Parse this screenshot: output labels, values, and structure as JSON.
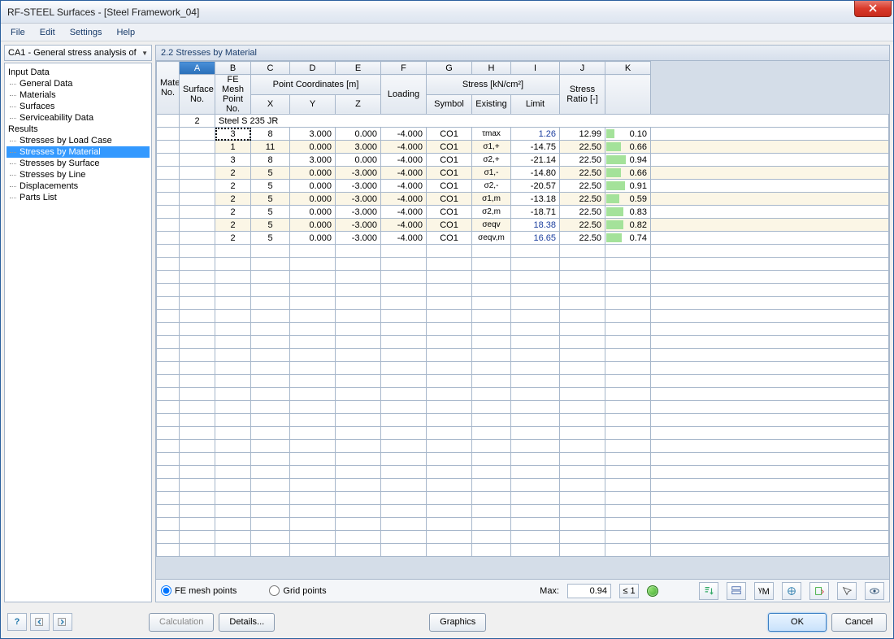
{
  "window": {
    "title": "RF-STEEL Surfaces - [Steel Framework_04]"
  },
  "menu": {
    "file": "File",
    "edit": "Edit",
    "settings": "Settings",
    "help": "Help"
  },
  "case_selector": {
    "label": "CA1 - General stress analysis of"
  },
  "tree": {
    "input_data": "Input Data",
    "general_data": "General Data",
    "materials": "Materials",
    "surfaces": "Surfaces",
    "serviceability": "Serviceability Data",
    "results": "Results",
    "by_load_case": "Stresses by Load Case",
    "by_material": "Stresses by Material",
    "by_surface": "Stresses by Surface",
    "by_line": "Stresses by Line",
    "displacements": "Displacements",
    "parts_list": "Parts List"
  },
  "section_title": "2.2 Stresses by Material",
  "columns": {
    "letters": [
      "A",
      "B",
      "C",
      "D",
      "E",
      "F",
      "G",
      "H",
      "I",
      "J",
      "K"
    ],
    "material_no": "Material\nNo.",
    "surface_no": "Surface\nNo.",
    "fe_mesh": "FE Mesh\nPoint No.",
    "point_coords": "Point Coordinates [m]",
    "x": "X",
    "y": "Y",
    "z": "Z",
    "loading": "Loading",
    "stress_group": "Stress [kN/cm²]",
    "symbol": "Symbol",
    "existing": "Existing",
    "limit": "Limit",
    "ratio": "Stress\nRatio [-]"
  },
  "group": {
    "mat_no": "2",
    "name": "Steel S 235 JR"
  },
  "rows": [
    {
      "surf": "3",
      "pt": "8",
      "x": "3.000",
      "y": "0.000",
      "z": "-4.000",
      "load": "CO1",
      "sym": "τmax",
      "ex": "1.26",
      "ex_neg": false,
      "lim": "12.99",
      "ratio": "0.10",
      "bar": 10
    },
    {
      "surf": "1",
      "pt": "11",
      "x": "0.000",
      "y": "3.000",
      "z": "-4.000",
      "load": "CO1",
      "sym": "σ1,+",
      "ex": "-14.75",
      "ex_neg": true,
      "lim": "22.50",
      "ratio": "0.66",
      "bar": 18
    },
    {
      "surf": "3",
      "pt": "8",
      "x": "3.000",
      "y": "0.000",
      "z": "-4.000",
      "load": "CO1",
      "sym": "σ2,+",
      "ex": "-21.14",
      "ex_neg": true,
      "lim": "22.50",
      "ratio": "0.94",
      "bar": 24
    },
    {
      "surf": "2",
      "pt": "5",
      "x": "0.000",
      "y": "-3.000",
      "z": "-4.000",
      "load": "CO1",
      "sym": "σ1,-",
      "ex": "-14.80",
      "ex_neg": true,
      "lim": "22.50",
      "ratio": "0.66",
      "bar": 18
    },
    {
      "surf": "2",
      "pt": "5",
      "x": "0.000",
      "y": "-3.000",
      "z": "-4.000",
      "load": "CO1",
      "sym": "σ2,-",
      "ex": "-20.57",
      "ex_neg": true,
      "lim": "22.50",
      "ratio": "0.91",
      "bar": 23
    },
    {
      "surf": "2",
      "pt": "5",
      "x": "0.000",
      "y": "-3.000",
      "z": "-4.000",
      "load": "CO1",
      "sym": "σ1,m",
      "ex": "-13.18",
      "ex_neg": true,
      "lim": "22.50",
      "ratio": "0.59",
      "bar": 16
    },
    {
      "surf": "2",
      "pt": "5",
      "x": "0.000",
      "y": "-3.000",
      "z": "-4.000",
      "load": "CO1",
      "sym": "σ2,m",
      "ex": "-18.71",
      "ex_neg": true,
      "lim": "22.50",
      "ratio": "0.83",
      "bar": 21
    },
    {
      "surf": "2",
      "pt": "5",
      "x": "0.000",
      "y": "-3.000",
      "z": "-4.000",
      "load": "CO1",
      "sym": "σeqv",
      "ex": "18.38",
      "ex_neg": false,
      "lim": "22.50",
      "ratio": "0.82",
      "bar": 21
    },
    {
      "surf": "2",
      "pt": "5",
      "x": "0.000",
      "y": "-3.000",
      "z": "-4.000",
      "load": "CO1",
      "sym": "σeqv,m",
      "ex": "16.65",
      "ex_neg": false,
      "lim": "22.50",
      "ratio": "0.74",
      "bar": 19
    }
  ],
  "bottom": {
    "fe_mesh_points": "FE mesh points",
    "grid_points": "Grid points",
    "max_label": "Max:",
    "max_value": "0.94",
    "le1": "≤ 1"
  },
  "footer": {
    "calculation": "Calculation",
    "details": "Details...",
    "graphics": "Graphics",
    "ok": "OK",
    "cancel": "Cancel"
  }
}
